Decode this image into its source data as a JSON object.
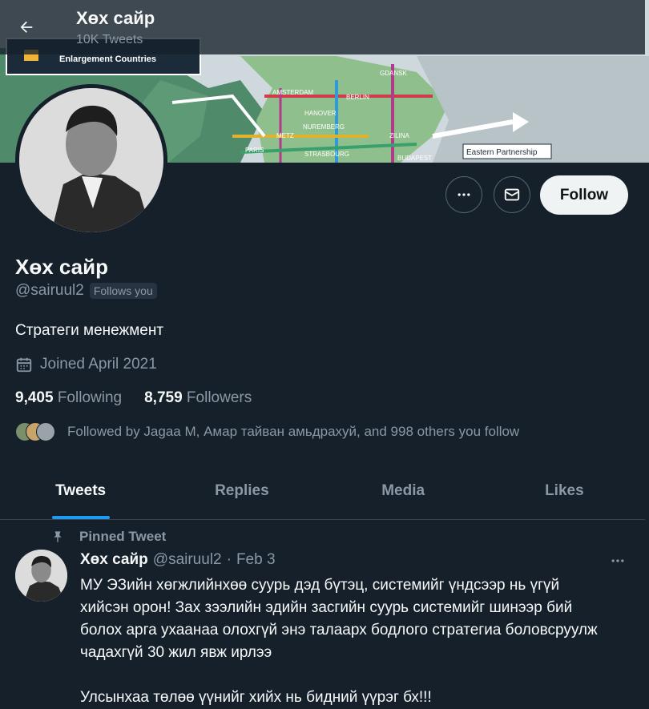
{
  "header": {
    "title": "Хөх сайр",
    "tweet_count": "10K Tweets"
  },
  "banner": {
    "legend_text": "Enlargement Countries",
    "map_labels": [
      "GDANSK",
      "AMSTERDAM",
      "BERLIN",
      "HANOVER",
      "NUREMBERG",
      "ZILINA",
      "PARIS",
      "METZ",
      "STRASBOURG",
      "BUDAPEST",
      "Eastern Partnership"
    ]
  },
  "profile": {
    "name": "Хөх сайр",
    "handle": "@sairuul2",
    "follows_you": "Follows you",
    "bio": "Стратеги менежмент",
    "joined": "Joined April 2021",
    "following_count": "9,405",
    "following_label": "Following",
    "followers_count": "8,759",
    "followers_label": "Followers",
    "followed_by": "Followed by Jagaa M, Амар тайван амьдрахуй, and 998 others you follow",
    "follow_button": "Follow"
  },
  "tabs": [
    {
      "label": "Tweets",
      "active": true
    },
    {
      "label": "Replies",
      "active": false
    },
    {
      "label": "Media",
      "active": false
    },
    {
      "label": "Likes",
      "active": false
    }
  ],
  "pinned_tweet": {
    "pinned_label": "Pinned Tweet",
    "author_name": "Хөх сайр",
    "author_handle": "@sairuul2",
    "separator": "·",
    "date": "Feb 3",
    "paragraphs": [
      "МУ ЭЗийн хөгжлийнхөө суурь дэд бүтэц, системийг үндсээр нь үгүй хийсэн орон! Зах зээлийн эдийн засгийн суурь системийг шинээр бий болох арга ухаанаа олохгүй энэ талаарх бодлого стратегиа боловсруулж чадахгүй 30 жил явж ирлээ",
      "Улсынхаа төлөө үүнийг хийх нь бидний үүрэг бх!!!"
    ]
  },
  "colors": {
    "background": "#15202b",
    "accent": "#1d9bf0",
    "muted_text": "#8b98a5",
    "border": "#38444d"
  },
  "icons": [
    "back-arrow-icon",
    "more-icon",
    "message-icon",
    "calendar-icon",
    "pin-icon"
  ]
}
